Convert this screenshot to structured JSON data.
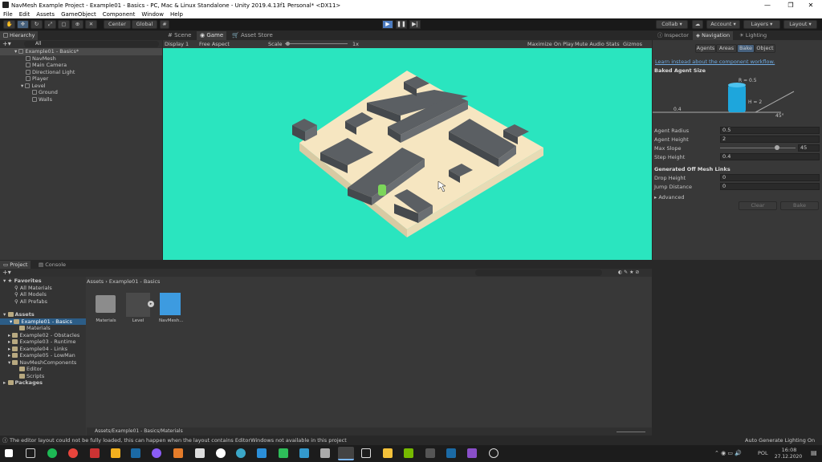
{
  "window": {
    "title": "NavMesh Example Project - Example01 - Basics - PC, Mac & Linux Standalone - Unity 2019.4.13f1 Personal* <DX11>",
    "minimize": "—",
    "maximize": "❐",
    "close": "✕"
  },
  "menu": [
    "File",
    "Edit",
    "Assets",
    "GameObject",
    "Component",
    "Window",
    "Help"
  ],
  "toolbar": {
    "pivot": "Center",
    "space": "Global",
    "collab": "Collab ▾",
    "account": "Account ▾",
    "layers": "Layers ▾",
    "layout": "Layout ▾"
  },
  "hierarchy": {
    "title": "Hierarchy",
    "search": "All",
    "scene": "Example01 - Basics*",
    "items": [
      "NavMesh",
      "Main Camera",
      "Directional Light",
      "Player",
      "Level",
      "Ground",
      "Walls"
    ]
  },
  "viewtabs": {
    "scene": "Scene",
    "game": "Game",
    "store": "Asset Store"
  },
  "gamebar": {
    "display": "Display 1",
    "aspect": "Free Aspect",
    "scale_label": "Scale",
    "scale_value": "1x",
    "maximize": "Maximize On Play",
    "mute": "Mute Audio",
    "stats": "Stats",
    "gizmos": "Gizmos"
  },
  "inspector": {
    "tabs": [
      "Inspector",
      "Navigation",
      "Lighting"
    ],
    "subtabs": [
      "Agents",
      "Areas",
      "Bake",
      "Object"
    ],
    "link": "Learn instead about the component workflow.",
    "section": "Baked Agent Size",
    "diagram": {
      "r": "R = 0.5",
      "h": "H = 2",
      "step": "0.4",
      "angle": "45°"
    },
    "fields": [
      {
        "label": "Agent Radius",
        "value": "0.5"
      },
      {
        "label": "Agent Height",
        "value": "2"
      },
      {
        "label": "Max Slope",
        "value": "45"
      },
      {
        "label": "Step Height",
        "value": "0.4"
      }
    ],
    "offmesh": "Generated Off Mesh Links",
    "fields2": [
      {
        "label": "Drop Height",
        "value": "0"
      },
      {
        "label": "Jump Distance",
        "value": "0"
      }
    ],
    "advanced": "Advanced",
    "clear": "Clear",
    "bake": "Bake",
    "slope_fraction": 0.75
  },
  "project": {
    "tabs": [
      "Project",
      "Console"
    ],
    "favorites": "Favorites",
    "fav_items": [
      "All Materials",
      "All Models",
      "All Prefabs"
    ],
    "assets": "Assets",
    "tree": [
      "Example01 - Basics",
      "Materials",
      "Example02 - Obstacles",
      "Example03 - Runtime",
      "Example04 - Links",
      "Example05 - LowMan",
      "NavMeshComponents",
      "Editor",
      "Scripts"
    ],
    "packages": "Packages",
    "breadcrumb": [
      "Assets",
      "Example01 - Basics"
    ],
    "files": [
      "Materials",
      "Level",
      "NavMesh..."
    ],
    "path": "Assets/Example01 - Basics/Materials"
  },
  "status": {
    "message": "The editor layout could not be fully loaded, this can happen when the layout contains EditorWindows not available in this project",
    "right": "Auto Generate Lighting On"
  },
  "taskbar": {
    "lang": "POL",
    "time": "16:08",
    "date": "27.12.2020"
  }
}
